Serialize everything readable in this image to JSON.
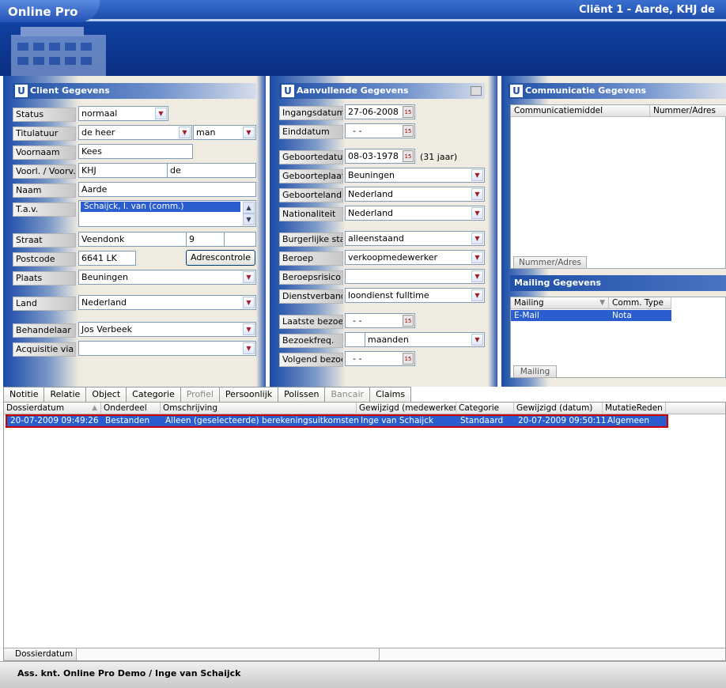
{
  "app": {
    "name": "Online Pro",
    "title": "Cliënt 1  -  Aarde, KHJ de"
  },
  "client": {
    "title": "Client Gegevens",
    "status": {
      "label": "Status",
      "value": "normaal"
    },
    "titulatuur": {
      "label": "Titulatuur",
      "value": "de heer",
      "value2": "man"
    },
    "voornaam": {
      "label": "Voornaam",
      "value": "Kees"
    },
    "voorl": {
      "label": "Voorl. / Voorv.",
      "value": "KHJ",
      "value2": "de"
    },
    "naam": {
      "label": "Naam",
      "value": "Aarde"
    },
    "tav": {
      "label": "T.a.v.",
      "value": "Schaijck, I. van (comm.)"
    },
    "straat": {
      "label": "Straat",
      "value": "Veendonk",
      "number": "9",
      "suffix": ""
    },
    "postcode": {
      "label": "Postcode",
      "value": "6641 LK",
      "button": "Adrescontrole"
    },
    "plaats": {
      "label": "Plaats",
      "value": "Beuningen"
    },
    "land": {
      "label": "Land",
      "value": "Nederland"
    },
    "behandelaar": {
      "label": "Behandelaar",
      "value": "Jos Verbeek"
    },
    "acquisitie": {
      "label": "Acquisitie via",
      "value": ""
    }
  },
  "extra": {
    "title": "Aanvullende Gegevens",
    "ingangsdatum": {
      "label": "Ingangsdatum",
      "value": "27-06-2008"
    },
    "einddatum": {
      "label": "Einddatum",
      "value": "- -"
    },
    "geboortedatum": {
      "label": "Geboortedatum",
      "value": "08-03-1978",
      "age": "(31 jaar)"
    },
    "geboorteplaats": {
      "label": "Geboorteplaats",
      "value": "Beuningen"
    },
    "geboorteland": {
      "label": "Geboorteland",
      "value": "Nederland"
    },
    "nationaliteit": {
      "label": "Nationaliteit",
      "value": "Nederland"
    },
    "burgerlijke": {
      "label": "Burgerlijke staat",
      "value": "alleenstaand"
    },
    "beroep": {
      "label": "Beroep",
      "value": "verkoopmedewerker"
    },
    "beroepsrisico": {
      "label": "Beroepsrisico",
      "value": ""
    },
    "dienstverband": {
      "label": "Dienstverband",
      "value": "loondienst fulltime"
    },
    "laatste": {
      "label": "Laatste bezoek",
      "value": "- -"
    },
    "bezoekfreq": {
      "label": "Bezoekfreq.",
      "value": "",
      "unit": "maanden"
    },
    "volgend": {
      "label": "Volgend bezoek",
      "value": "- -"
    }
  },
  "comm": {
    "title": "Communicatie Gegevens",
    "col1": "Communicatiemiddel",
    "col2": "Nummer/Adres",
    "footer": "Nummer/Adres"
  },
  "mailing": {
    "title": "Mailing Gegevens",
    "col1": "Mailing",
    "col2": "Comm. Type",
    "row": {
      "mailing": "E-Mail",
      "type": "Nota"
    },
    "footer": "Mailing"
  },
  "tabs": [
    {
      "label": "Notitie"
    },
    {
      "label": "Relatie"
    },
    {
      "label": "Object"
    },
    {
      "label": "Categorie"
    },
    {
      "label": "Profiel"
    },
    {
      "label": "Persoonlijk"
    },
    {
      "label": "Polissen"
    },
    {
      "label": "Bancair"
    },
    {
      "label": "Claims"
    }
  ],
  "grid": {
    "columns": [
      "Dossierdatum",
      "Onderdeel",
      "Omschrijving",
      "Gewijzigd (medewerker)",
      "Categorie",
      "Gewijzigd (datum)",
      "MutatieReden"
    ],
    "row": [
      "20-07-2009 09:49:26",
      "Bestanden",
      "Alleen (geselecteerde) berekeningsuitkomsten",
      "Inge van Schaijck",
      "Standaard",
      "20-07-2009 09:50:11",
      "Algemeen"
    ],
    "footer": "Dossierdatum"
  },
  "status": "Ass. knt. Online Pro Demo / Inge van Schaijck"
}
